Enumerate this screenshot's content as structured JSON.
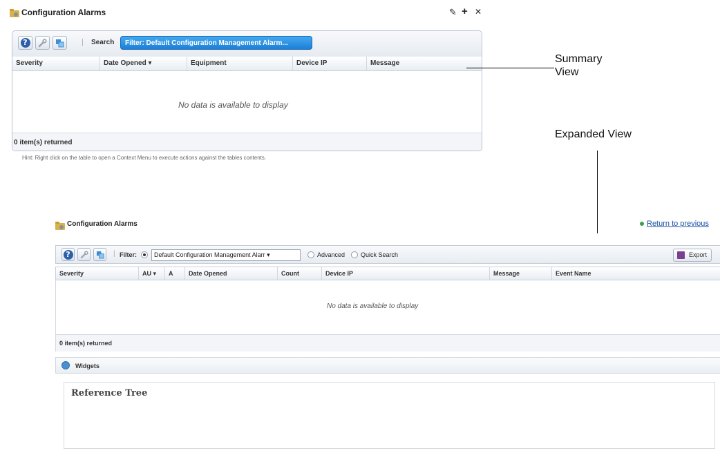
{
  "summary": {
    "title": "Configuration Alarms",
    "window_controls": {
      "settings": "✎",
      "add": "+",
      "close": "✕"
    },
    "toolbar": {
      "separator": "|",
      "search_label": "Search",
      "filter_label": "Filter: Default Configuration Management Alarm..."
    },
    "columns": [
      "Severity",
      "Date Opened ▾",
      "Equipment",
      "Device IP",
      "Message"
    ],
    "empty_message": "No data is available to display",
    "footer": "0 item(s) returned",
    "hint": "Hint: Right click on the table to open a Context Menu to execute actions against the tables contents."
  },
  "annotations": {
    "summary_line1": "Summary",
    "summary_line2": "View",
    "expanded": "Expanded View"
  },
  "expanded": {
    "title": "Configuration Alarms",
    "return_link": "Return to previous",
    "toolbar": {
      "separator": "|",
      "filter_label": "Filter:",
      "filter_value": "Default Configuration Management Alarr ▾",
      "advanced_label": "Advanced",
      "quick_search_label": "Quick Search",
      "export_label": "Export"
    },
    "columns": [
      "Severity",
      "AU ▾",
      "A",
      "Date Opened",
      "Count",
      "Device IP",
      "Message",
      "Event Name"
    ],
    "empty_message": "No data is available to display",
    "footer": "0 item(s) returned",
    "widgets_label": "Widgets",
    "reference_tree_label": "Reference Tree"
  },
  "colors": {
    "filter_pill": "#1e7fd6",
    "help_icon": "#2d5fa8",
    "return_link": "#1a4fa0",
    "return_bullet": "#3aa14a"
  }
}
